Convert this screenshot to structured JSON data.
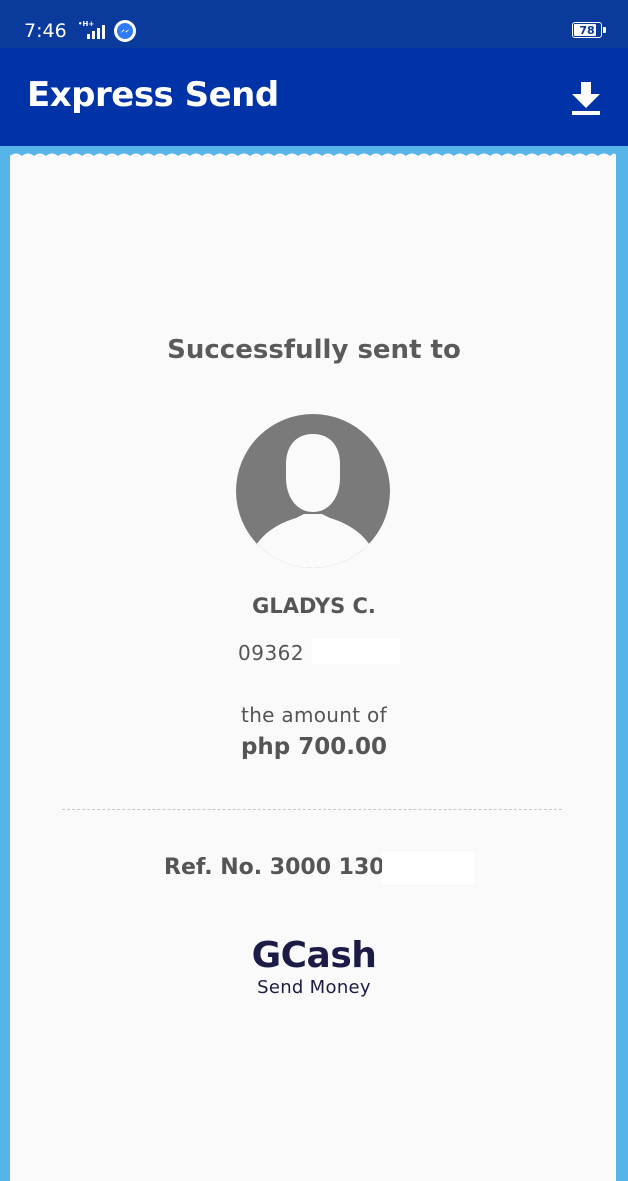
{
  "status_bar": {
    "time": "7:46",
    "battery": "78",
    "icons": [
      "signal-icon",
      "messenger-icon",
      "battery-icon"
    ]
  },
  "app_bar": {
    "title": "Express Send",
    "download_icon": "download-icon"
  },
  "receipt": {
    "heading": "Successfully sent to",
    "recipient_name": "GLADYS C.",
    "recipient_number": "09362",
    "amount_label": "the amount of",
    "amount_value": "php 700.00",
    "ref_no": "Ref. No. 3000 1309",
    "brand": "GCash",
    "brand_sub": "Send Money"
  },
  "colors": {
    "status_bar": "#0a3a9c",
    "app_bar": "#0033a8",
    "receipt_border": "#56b4e9",
    "receipt_bg": "#fafafa",
    "text_gray": "#555555",
    "brand_navy": "#1b1b46",
    "avatar_gray": "#7a7a7a"
  }
}
